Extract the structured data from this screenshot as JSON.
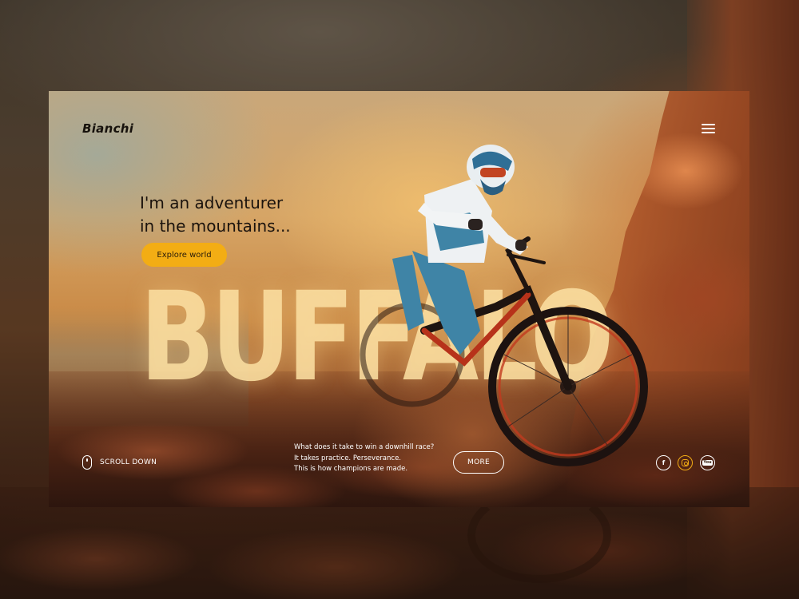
{
  "header": {
    "logo_text": "Bianchi",
    "menu_icon": "hamburger-menu-icon"
  },
  "hero": {
    "headline_line1": "I'm an adventurer",
    "headline_line2": "in the mountains...",
    "explore_label": "Explore world",
    "big_word": "BUFFALO"
  },
  "footer": {
    "scroll_label": "SCROLL DOWN",
    "scroll_icon": "mouse-icon",
    "tagline": [
      "What does it take to win a downhill race?",
      "It takes practice. Perseverance.",
      "This is how champions are made."
    ],
    "more_label": "MORE",
    "social": {
      "facebook_glyph": "f",
      "instagram_icon": "instagram-icon",
      "youtube_glyph": "You"
    }
  },
  "colors": {
    "accent": "#f3ad14",
    "text_dark": "#1b130d",
    "text_light": "#ffffff"
  }
}
